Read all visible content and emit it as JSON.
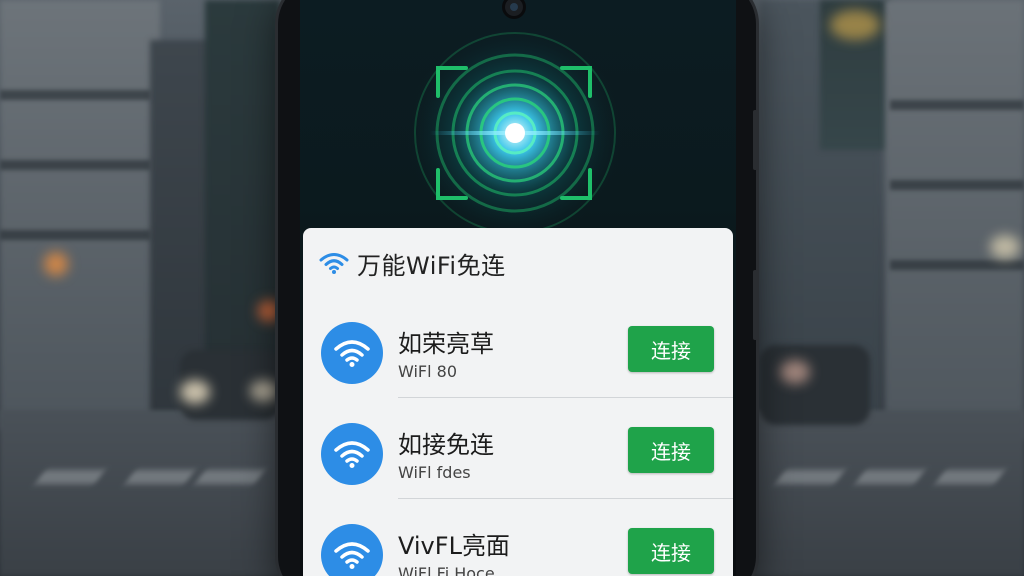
{
  "app": {
    "title": "万能WiFi免连"
  },
  "networks": [
    {
      "name": "如荣亮草",
      "subtitle": "WiFl 80",
      "button_label": "连接"
    },
    {
      "name": "如接免连",
      "subtitle": "WiFl fdes",
      "button_label": "连接"
    },
    {
      "name": "VivFL亮面",
      "subtitle": "WiFl Fi Hoce",
      "button_label": "连接"
    }
  ],
  "icons": {
    "header": "wifi-icon",
    "network": "wifi-icon",
    "scanner": "scan-frame-icon"
  },
  "colors": {
    "accent_blue": "#2d8de6",
    "connect_green": "#1fa34a",
    "scanner_green": "#1fbf6a",
    "scanner_glow": "#35d6ff"
  }
}
